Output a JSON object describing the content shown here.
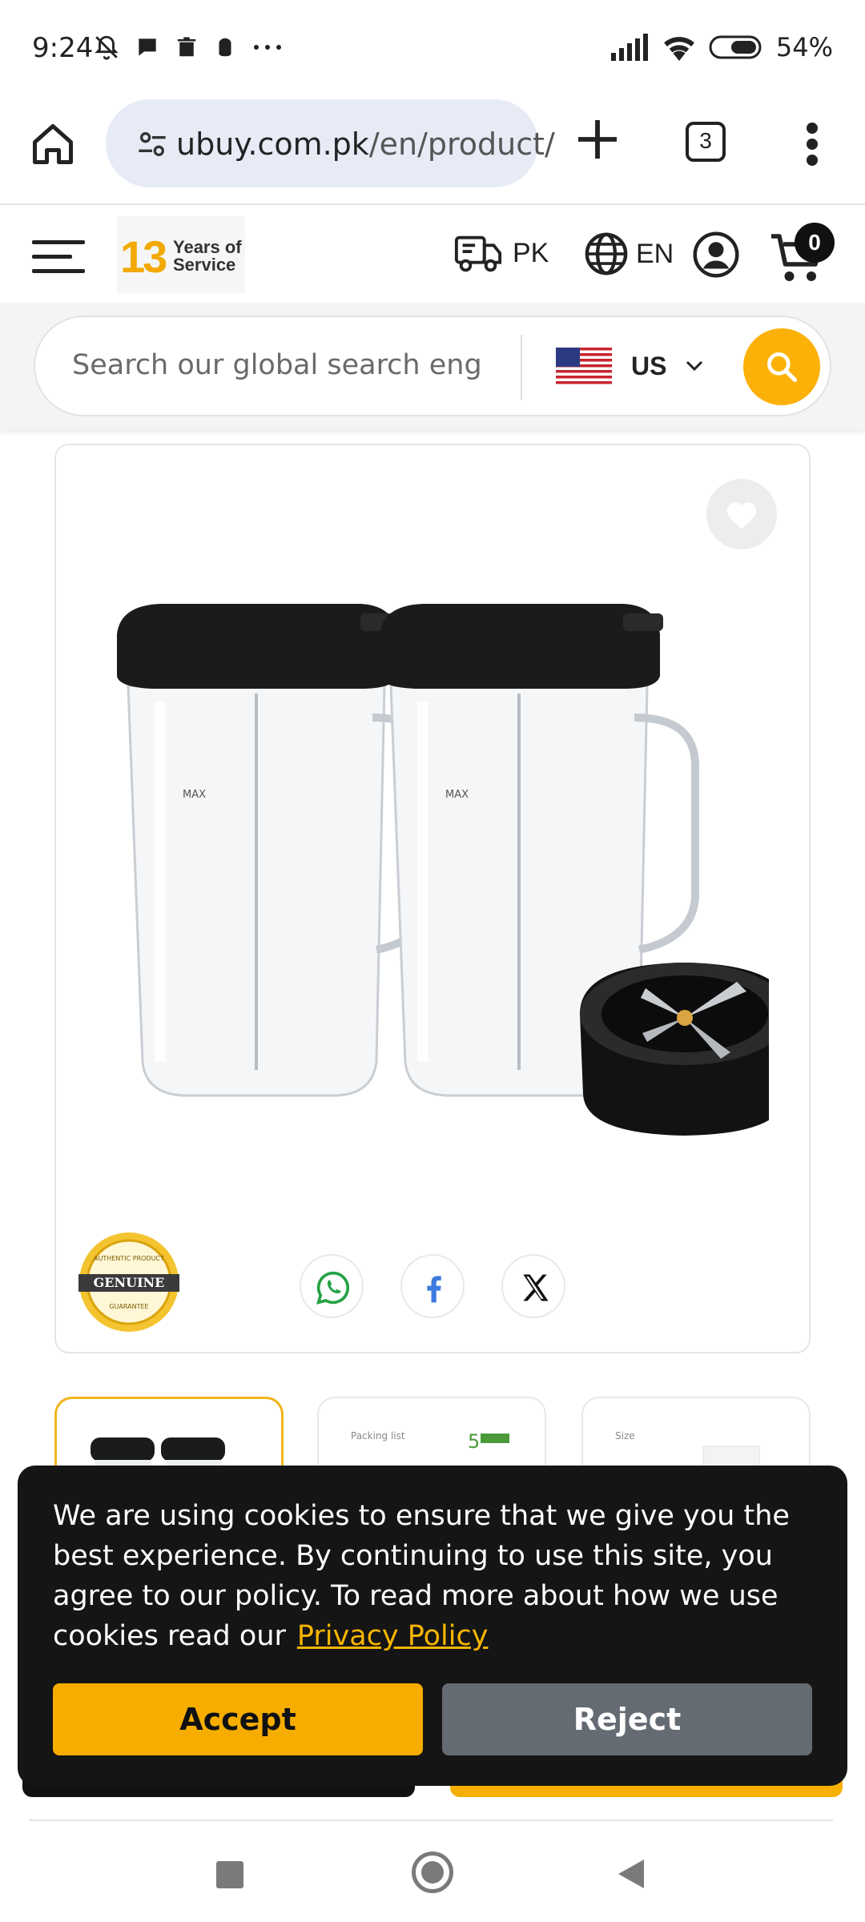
{
  "status_bar": {
    "time": "9:24",
    "battery": "54%",
    "icons": [
      "bell-off-icon",
      "chat-icon",
      "trash-icon",
      "app-icon",
      "more-icon",
      "signal-icon",
      "wifi-icon",
      "battery-icon"
    ]
  },
  "browser": {
    "url_host": "ubuy.com.pk",
    "url_path": "/en/product/",
    "tab_count": "3"
  },
  "header": {
    "logo_number": "13",
    "logo_line1": "Years of",
    "logo_line2": "Service",
    "ship_to": "PK",
    "language": "EN",
    "cart_count": "0"
  },
  "search": {
    "placeholder": "Search our global search eng",
    "country": "US"
  },
  "product": {
    "badge_top": "AUTHENTIC PRODUCT",
    "badge_main": "GENUINE",
    "badge_bottom": "GUARANTEE",
    "thumbnails": [
      {
        "caption": ""
      },
      {
        "caption": "Packing list"
      },
      {
        "caption": "Size"
      }
    ]
  },
  "cookie": {
    "message": "We are using cookies to ensure that we give you the best experience. By continuing to use this site, you agree to our policy. To read more about how we use cookies read our",
    "link_label": "Privacy Policy",
    "accept_label": "Accept",
    "reject_label": "Reject"
  },
  "colors": {
    "accent": "#F6AD00",
    "banner_bg": "#151515",
    "reject_bg": "#656B73",
    "url_pill": "#E6EBF6"
  }
}
